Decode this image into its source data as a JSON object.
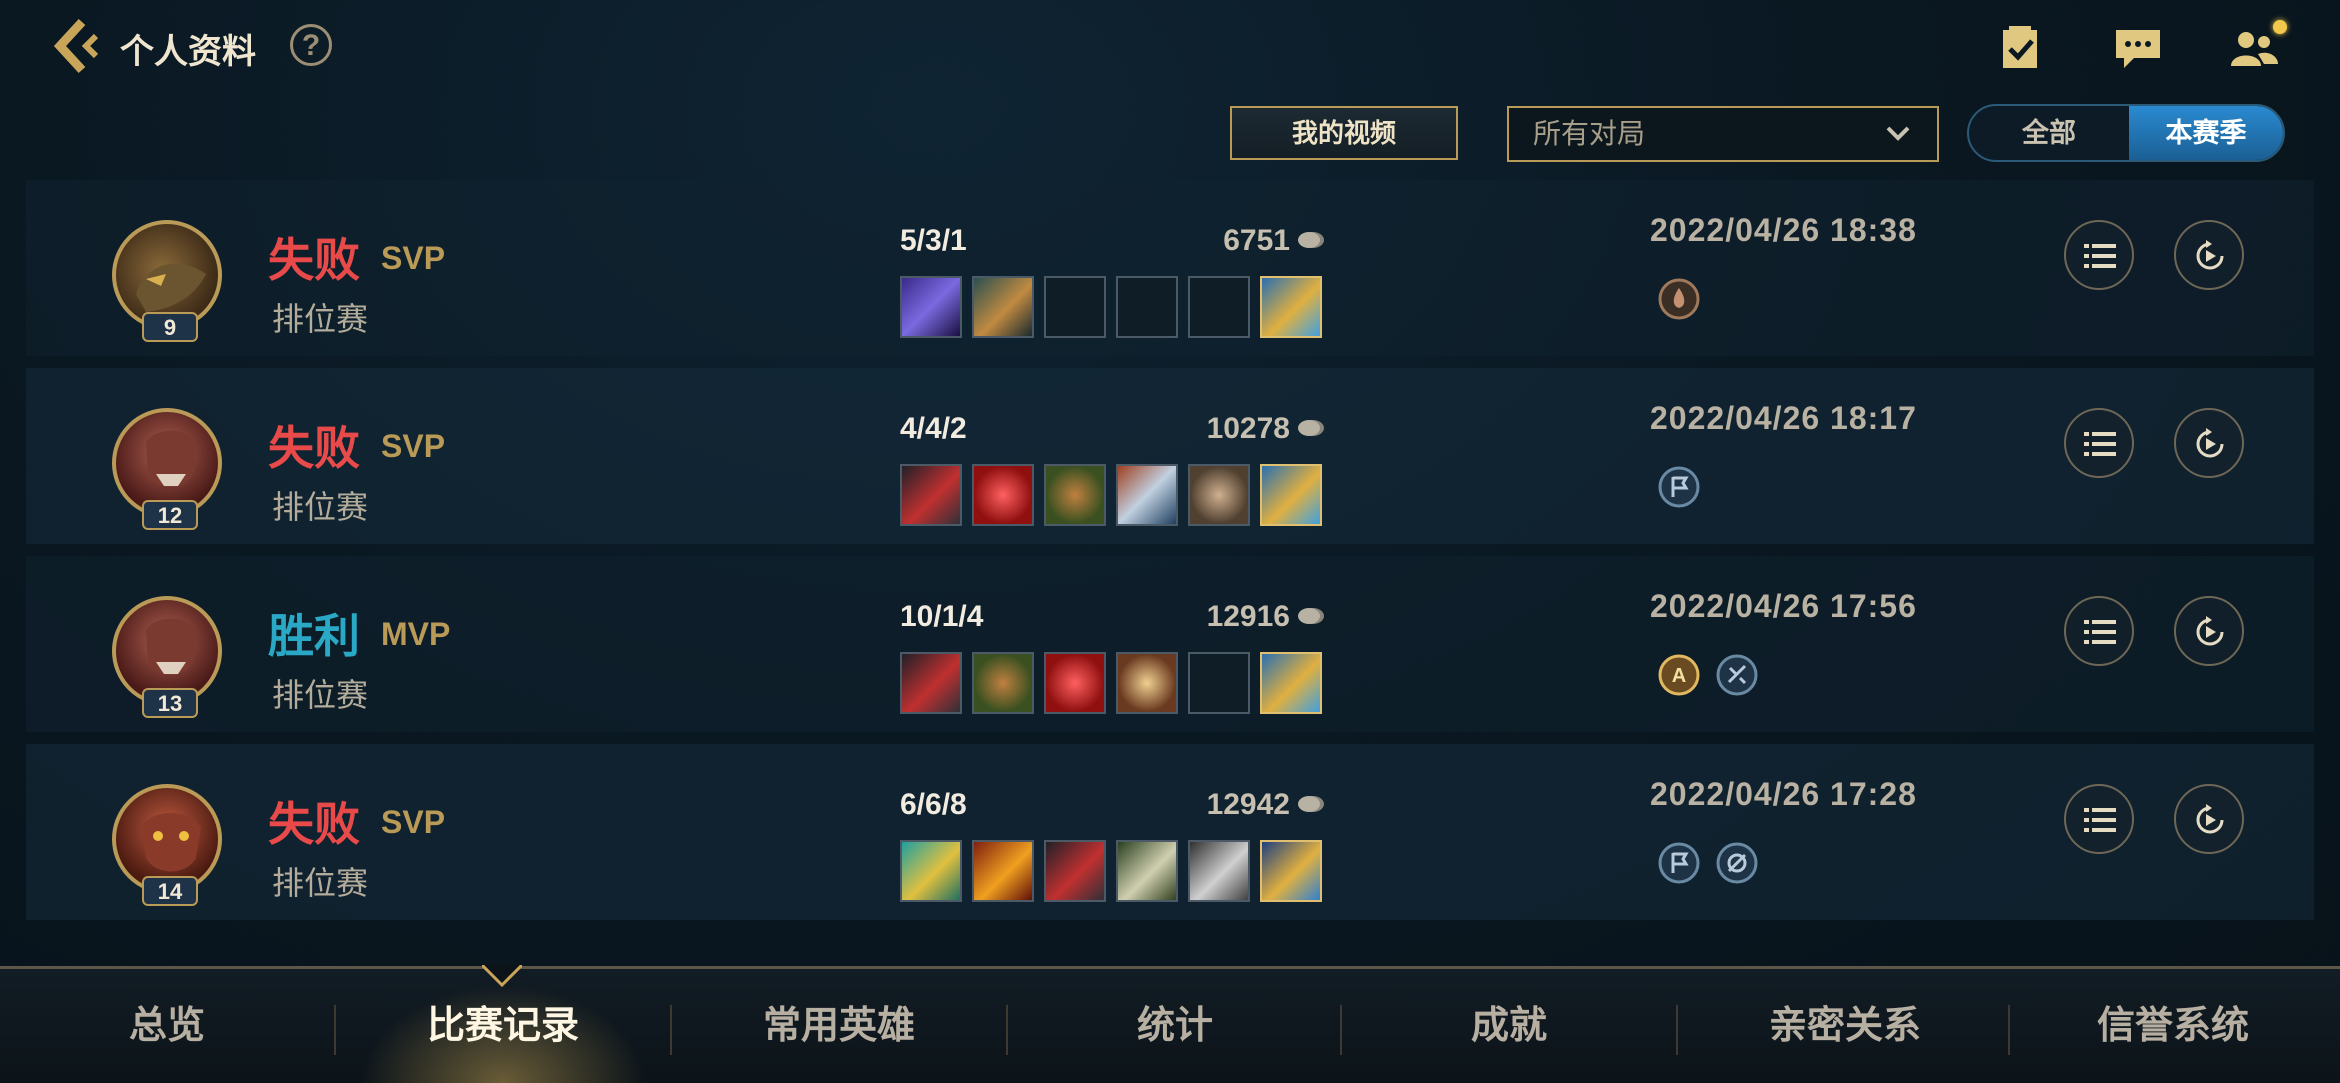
{
  "header": {
    "title": "个人资料",
    "help_label": "?"
  },
  "filters": {
    "video_button": "我的视频",
    "match_filter": "所有对局",
    "toggle_all": "全部",
    "toggle_season": "本赛季"
  },
  "matches": [
    {
      "result": "失败",
      "outcome": "lose",
      "rank": "SVP",
      "mode": "排位赛",
      "level": "9",
      "kda": "5/3/1",
      "gold": "6751",
      "time": "2022/04/26 18:38"
    },
    {
      "result": "失败",
      "outcome": "lose",
      "rank": "SVP",
      "mode": "排位赛",
      "level": "12",
      "kda": "4/4/2",
      "gold": "10278",
      "time": "2022/04/26 18:17"
    },
    {
      "result": "胜利",
      "outcome": "win",
      "rank": "MVP",
      "mode": "排位赛",
      "level": "13",
      "kda": "10/1/4",
      "gold": "12916",
      "time": "2022/04/26 17:56"
    },
    {
      "result": "失败",
      "outcome": "lose",
      "rank": "SVP",
      "mode": "排位赛",
      "level": "14",
      "kda": "6/6/8",
      "gold": "12942",
      "time": "2022/04/26 17:28"
    }
  ],
  "nav": {
    "tabs": [
      "总览",
      "比赛记录",
      "常用英雄",
      "统计",
      "成就",
      "亲密关系",
      "信誉系统"
    ],
    "active_index": 1
  },
  "colors": {
    "lose": "#e84a4a",
    "win": "#2aa9c6",
    "gold_accent": "#b99a57",
    "toggle_active": "#2a8ad0"
  },
  "icons": [
    "back-arrow-icon",
    "help-icon",
    "checklist-icon",
    "chat-icon",
    "friends-icon",
    "chevron-down-icon",
    "list-icon",
    "replay-icon",
    "coin-icon"
  ]
}
